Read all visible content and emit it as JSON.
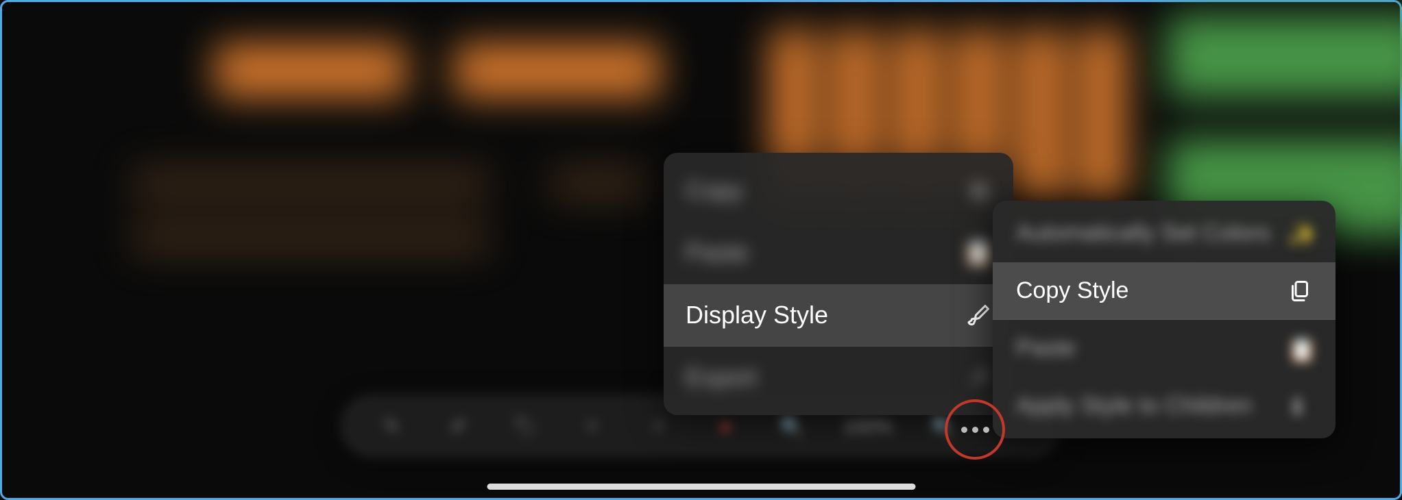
{
  "context_menu_1": {
    "items": [
      {
        "label": "Copy",
        "icon": "copy"
      },
      {
        "label": "Paste",
        "icon": "paste"
      },
      {
        "label": "Display Style",
        "icon": "paint-brush",
        "focused": true
      },
      {
        "label": "Export",
        "icon": "export"
      }
    ]
  },
  "context_menu_2": {
    "items": [
      {
        "label": "Automatically Set Colors",
        "icon": "wand"
      },
      {
        "label": "Copy Style",
        "icon": "copy-document",
        "focused": true
      },
      {
        "label": "Paste",
        "icon": "paste"
      },
      {
        "label": "Apply Style to Children",
        "icon": "apply"
      }
    ]
  },
  "toolbar": {
    "zoom_label": "100%",
    "items": [
      "eyedropper",
      "pencil",
      "tag",
      "plus",
      "plus-alt",
      "marker",
      "zoom-out",
      "zoom-label",
      "zoom-in",
      "more"
    ]
  }
}
